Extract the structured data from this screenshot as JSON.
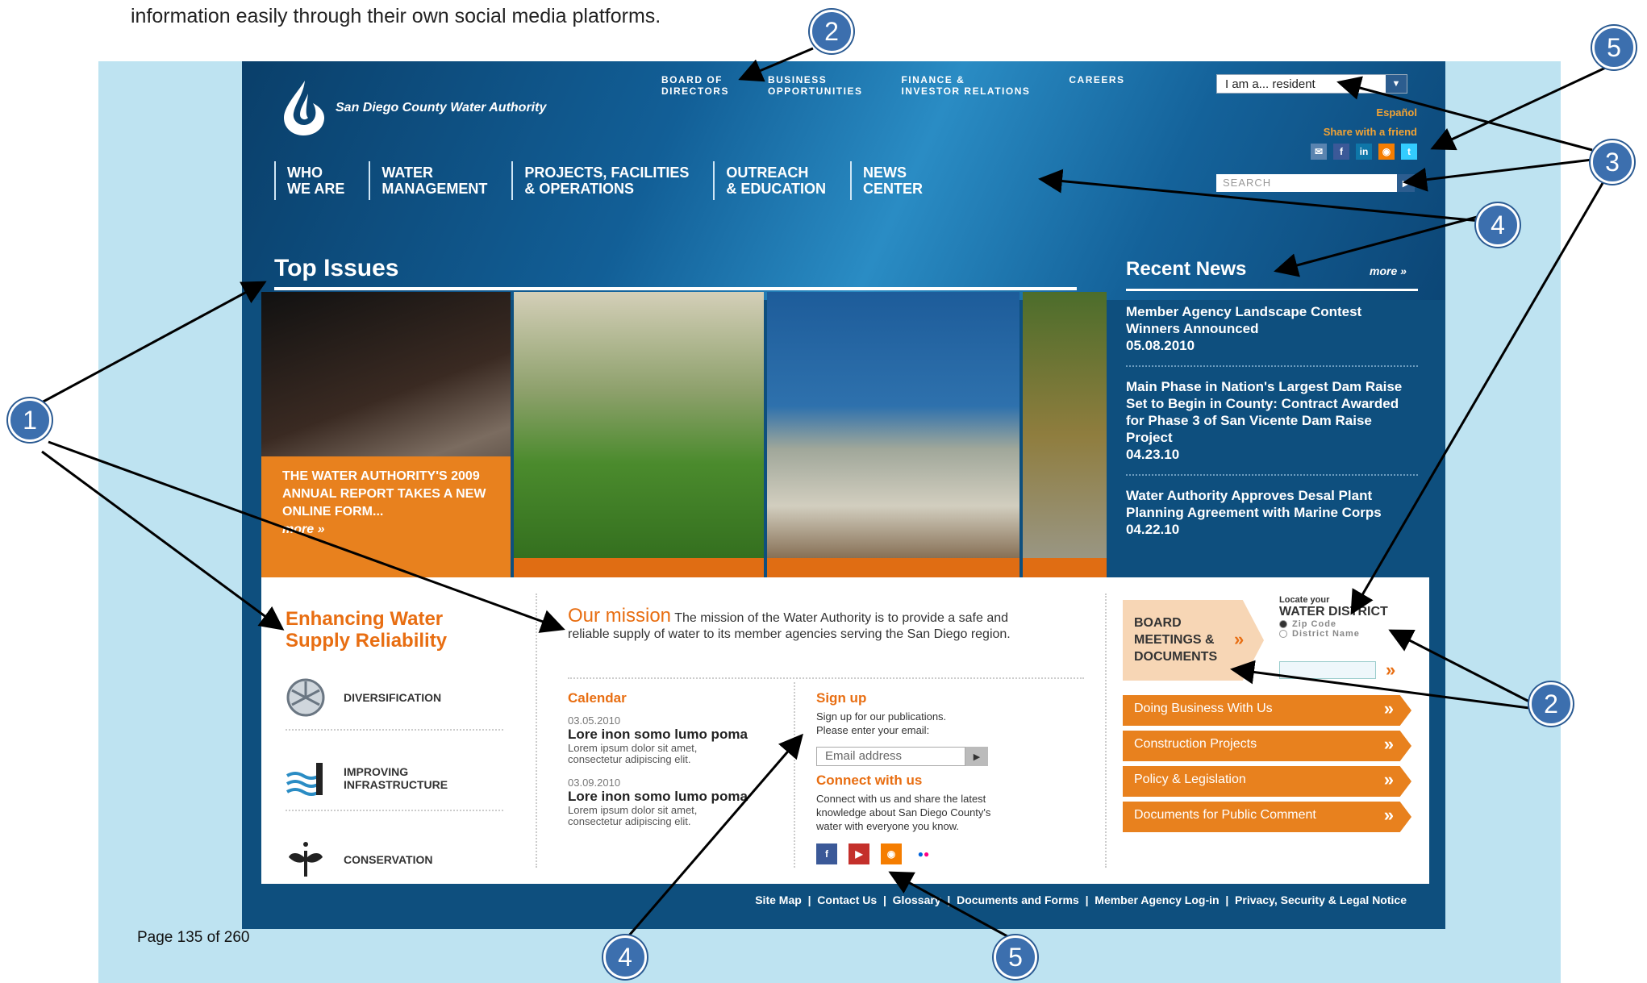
{
  "intro_text": "information easily through their own social media platforms.",
  "page_number": "Page 135 of 260",
  "site": {
    "logo_text": "San Diego County Water Authority",
    "utility_nav": [
      "BOARD OF\nDIRECTORS",
      "BUSINESS\nOPPORTUNITIES",
      "FINANCE &\nINVESTOR RELATIONS",
      "CAREERS"
    ],
    "iam_value": "I am a... resident",
    "espanol": "Español",
    "share": "Share with a friend",
    "search_placeholder": "SEARCH",
    "main_nav": [
      "WHO\nWE ARE",
      "WATER\nMANAGEMENT",
      "PROJECTS, FACILITIES\n& OPERATIONS",
      "OUTREACH\n& EDUCATION",
      "NEWS\nCENTER"
    ],
    "top_issues_title": "Top Issues",
    "slide_caption": "THE WATER AUTHORITY'S 2009 ANNUAL REPORT TAKES A NEW ONLINE FORM...",
    "slide_more": "more »",
    "recent_news_title": "Recent News",
    "recent_more": "more »",
    "news": [
      {
        "title": "Member Agency Landscape Contest Winners Announced",
        "date": "05.08.2010"
      },
      {
        "title": "Main Phase in Nation's Largest Dam Raise Set to Begin in County: Contract Awarded for Phase 3 of San Vicente Dam Raise Project",
        "date": "04.23.10"
      },
      {
        "title": "Water Authority Approves Desal Plant Planning Agreement with Marine Corps",
        "date": "04.22.10"
      }
    ],
    "enhancing_title": "Enhancing Water Supply Reliability",
    "enhancing_items": [
      "DIVERSIFICATION",
      "IMPROVING\nINFRASTRUCTURE",
      "CONSERVATION"
    ],
    "mission_head": "Our mission",
    "mission_text": " The mission of the Water Authority is to provide a safe and reliable supply of water to its member agencies serving the San Diego region.",
    "calendar_title": "Calendar",
    "calendar": [
      {
        "date": "03.05.2010",
        "name": "Lore inon somo lumo poma",
        "text": "Lorem ipsum dolor sit amet,\nconsectetur adipiscing elit."
      },
      {
        "date": "03.09.2010",
        "name": "Lore inon somo lumo poma",
        "text": "Lorem ipsum dolor sit amet,\nconsectetur adipiscing elit."
      }
    ],
    "signup_title": "Sign up",
    "signup_text": "Sign up for our publications.\nPlease enter your email:",
    "email_placeholder": "Email address",
    "connect_title": "Connect with us",
    "connect_text": "Connect with us and share the latest\nknowledge about San Diego County's\nwater with everyone you know.",
    "board_label": "BOARD\nMEETINGS &\nDOCUMENTS",
    "locate_small": "Locate your",
    "locate_big": "WATER DISTRICT",
    "radio_zip": "Zip Code",
    "radio_district": "District Name",
    "orange_buttons": [
      "Doing Business With Us",
      "Construction Projects",
      "Policy & Legislation",
      "Documents for Public Comment"
    ],
    "footer_links": [
      "Site Map",
      "Contact Us",
      "Glossary",
      "Documents and Forms",
      "Member Agency Log-in",
      "Privacy, Security & Legal Notice"
    ]
  },
  "badges": [
    "1",
    "2",
    "2",
    "3",
    "4",
    "4",
    "5",
    "5"
  ],
  "colors": {
    "accent_orange": "#e8811e",
    "header_blue": "#125f97",
    "badge_blue": "#3c6fae"
  }
}
